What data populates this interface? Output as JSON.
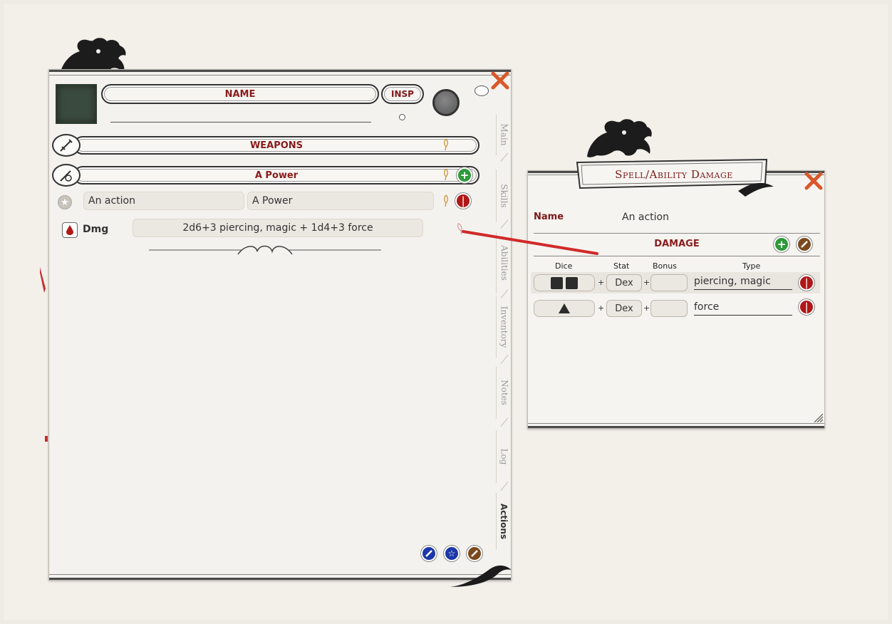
{
  "sheet": {
    "name_label": "NAME",
    "insp_label": "INSP",
    "weapons_label": "WEAPONS",
    "power_section_label": "A Power",
    "action_name": "An action",
    "action_power": "A Power",
    "dmg_label": "Dmg",
    "dmg_value": "2d6+3 piercing, magic + 1d4+3 force",
    "tabs": [
      "Main",
      "Skills",
      "Abilities",
      "Inventory",
      "Notes",
      "Log",
      "Actions"
    ],
    "active_tab": "Actions"
  },
  "popup": {
    "title": "Spell/Ability Damage",
    "name_label": "Name",
    "name_value": "An action",
    "damage_label": "DAMAGE",
    "columns": {
      "dice": "Dice",
      "stat": "Stat",
      "bonus": "Bonus",
      "type": "Type"
    },
    "rows": [
      {
        "dice": "2d6",
        "stat": "Dex",
        "bonus": "",
        "type": "piercing, magic"
      },
      {
        "dice": "1d4",
        "stat": "Dex",
        "bonus": "",
        "type": "force"
      }
    ],
    "plus_symbol": "+"
  },
  "icons": {
    "close": "close-x-icon",
    "quill": "quill-icon",
    "add": "plus-icon",
    "delete": "minus-icon",
    "edit": "pencil-icon",
    "dice_d6": "d6-die-icon",
    "dice_d4": "d4-die-icon"
  },
  "colors": {
    "accent_red": "#8a1c1c",
    "close_orange": "#d9572a",
    "add_green": "#2e9a3a",
    "delete_red": "#b01818",
    "edit_brown": "#7a4a1e",
    "blue": "#1c37a8"
  }
}
